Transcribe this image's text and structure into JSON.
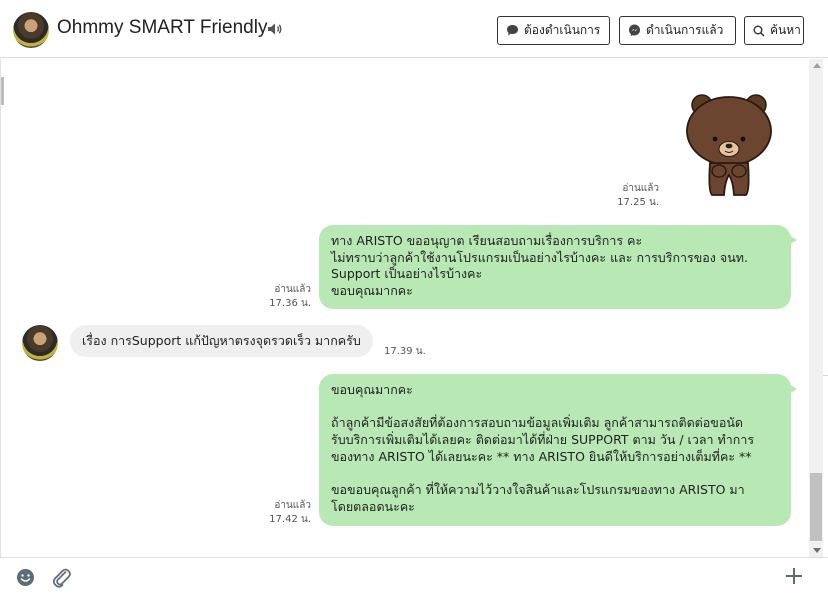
{
  "header": {
    "title": "Ohmmy SMART Friendly",
    "buttons": {
      "pending": "ต้องดำเนินการ",
      "done": "ดำเนินการแล้ว",
      "search": "ค้นหา"
    }
  },
  "messages": {
    "sticker": {
      "read": "อ่านแล้ว",
      "time": "17.25 น."
    },
    "out1": {
      "read": "อ่านแล้ว",
      "time": "17.36 น.",
      "lines": [
        "ทาง ARISTO ขออนุญาต เรียนสอบถามเรื่องการบริการ คะ",
        "ไม่ทราบว่าลูกค้าใช้งานโปรแกรมเป็นอย่างไรบ้างคะ และ การบริการของ จนท.",
        "Support เป็นอย่างไรบ้างคะ",
        "ขอบคุณมากคะ"
      ]
    },
    "in1": {
      "text": "เรื่อง การSupport แก้ปัญหาตรงจุดรวดเร็ว มากครับ",
      "time": "17.39 น."
    },
    "out2": {
      "read": "อ่านแล้ว",
      "time": "17.42 น.",
      "lines": [
        "ขอบคุณมากคะ",
        "",
        "ถ้าลูกค้ามีข้อสงสัยที่ต้องการสอบถามข้อมูลเพิ่มเติม ลูกค้าสามารถติดต่อขอนัด",
        "รับบริการเพิ่มเติมได้เลยคะ ติดต่อมาได้ที่ฝ่าย SUPPORT ตาม วัน / เวลา ทำการ",
        "ของทาง ARISTO ได้เลยนะคะ ** ทาง ARISTO ยินดีให้บริการอย่างเต็มที่คะ **",
        "",
        "ขอขอบคุณลูกค้า ที่ให้ความไว้วางใจสินค้าและโปรแกรมของทาง ARISTO มา",
        "โดยตลอดนะคะ"
      ]
    }
  },
  "icons": {
    "speaker": "speaker-icon",
    "pending": "chat-bubble-icon",
    "done": "messenger-icon",
    "search": "search-icon",
    "emoji": "emoji-icon",
    "attach": "paperclip-icon",
    "add": "plus-icon"
  },
  "colors": {
    "outgoing_bubble": "#b8e8b4",
    "incoming_bubble": "#efefef"
  }
}
